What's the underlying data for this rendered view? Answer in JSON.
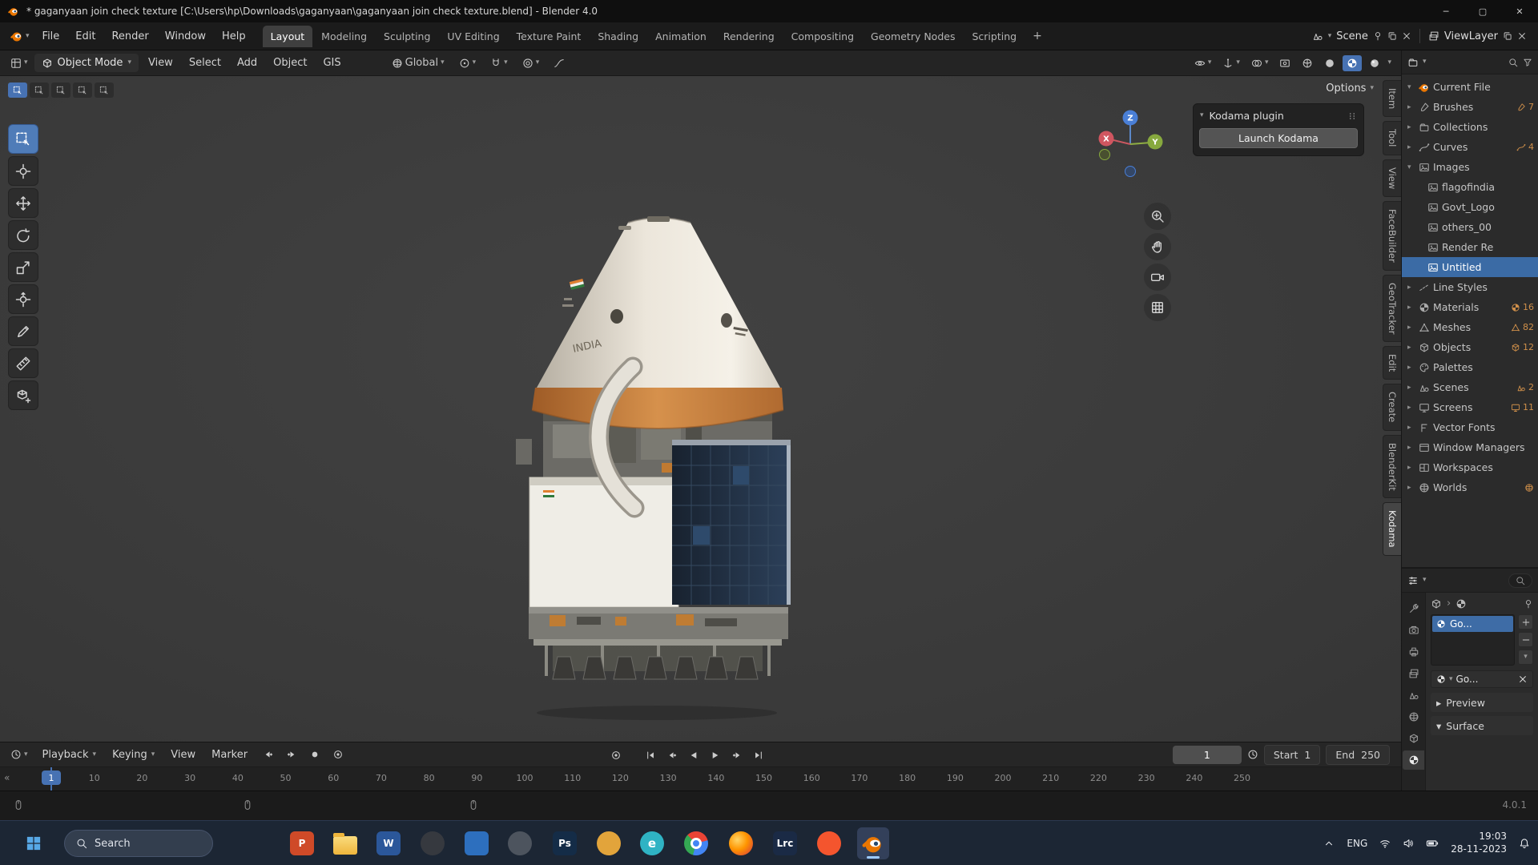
{
  "titlebar": {
    "title": "* gaganyaan join check texture [C:\\Users\\hp\\Downloads\\gaganyaan\\gaganyaan join check texture.blend] - Blender 4.0",
    "controls": {
      "minimize": "─",
      "maximize": "▢",
      "close": "✕"
    }
  },
  "topbar": {
    "menus": [
      "File",
      "Edit",
      "Render",
      "Window",
      "Help"
    ],
    "workspaces": [
      "Layout",
      "Modeling",
      "Sculpting",
      "UV Editing",
      "Texture Paint",
      "Shading",
      "Animation",
      "Rendering",
      "Compositing",
      "Geometry Nodes",
      "Scripting"
    ],
    "active_workspace": "Layout",
    "add_workspace_label": "+",
    "scene": {
      "label": "Scene"
    },
    "viewlayer": {
      "label": "ViewLayer"
    }
  },
  "viewport": {
    "header": {
      "mode_label": "Object Mode",
      "menus": [
        "View",
        "Select",
        "Add",
        "Object",
        "GIS"
      ],
      "orientation_label": "Global"
    },
    "options_label": "Options",
    "tools": [
      "select-box",
      "cursor",
      "move",
      "rotate",
      "scale",
      "transform",
      "annotate",
      "measure",
      "add-cube"
    ],
    "nav_controls": [
      "zoom",
      "pan",
      "camera",
      "grid"
    ],
    "gizmo": {
      "x": "X",
      "y": "Y",
      "z": "Z"
    },
    "side_tabs": [
      "Item",
      "Tool",
      "View",
      "FaceBuilder",
      "GeoTracker",
      "Edit",
      "Create",
      "BlenderKit",
      "Kodama"
    ],
    "active_side_tab": "Kodama",
    "kodama_panel": {
      "title": "Kodama plugin",
      "button_label": "Launch Kodama"
    },
    "model_label": "INDIA"
  },
  "outliner": {
    "root_label": "Current File",
    "items": [
      {
        "label": "Brushes",
        "icon": "brush",
        "count": "7"
      },
      {
        "label": "Collections",
        "icon": "collection",
        "count": ""
      },
      {
        "label": "Curves",
        "icon": "curve",
        "count": "4"
      },
      {
        "label": "Images",
        "icon": "image",
        "count": "",
        "expanded": true,
        "children": [
          {
            "label": "flagofindia",
            "selected": false
          },
          {
            "label": "Govt_Logo",
            "selected": false
          },
          {
            "label": "others_00",
            "selected": false
          },
          {
            "label": "Render Re",
            "selected": false
          },
          {
            "label": "Untitled",
            "selected": true
          }
        ]
      },
      {
        "label": "Line Styles",
        "icon": "linestyle",
        "count": ""
      },
      {
        "label": "Materials",
        "icon": "material",
        "count": "16"
      },
      {
        "label": "Meshes",
        "icon": "mesh",
        "count": "82"
      },
      {
        "label": "Objects",
        "icon": "object",
        "count": "12"
      },
      {
        "label": "Palettes",
        "icon": "palette",
        "count": ""
      },
      {
        "label": "Scenes",
        "icon": "scene",
        "count": "2"
      },
      {
        "label": "Screens",
        "icon": "screen",
        "count": "11"
      },
      {
        "label": "Vector Fonts",
        "icon": "font",
        "count": ""
      },
      {
        "label": "Window Managers",
        "icon": "window",
        "count": ""
      },
      {
        "label": "Workspaces",
        "icon": "workspace",
        "count": ""
      },
      {
        "label": "Worlds",
        "icon": "world",
        "count": "",
        "badge": true
      }
    ]
  },
  "properties": {
    "tabs": [
      "tool",
      "render",
      "output",
      "viewlayer",
      "scene",
      "world",
      "object",
      "material"
    ],
    "active_tab": "material",
    "material_slot_label": "Go...",
    "material_name": "Go...",
    "sections": [
      {
        "label": "Preview",
        "expanded": false
      },
      {
        "label": "Surface",
        "expanded": true
      }
    ]
  },
  "timeline": {
    "menus": [
      "Playback",
      "Keying",
      "View",
      "Marker"
    ],
    "current_frame": "1",
    "frame_field_value": "1",
    "start_label": "Start",
    "start_value": "1",
    "end_label": "End",
    "end_value": "250",
    "ticks": [
      10,
      20,
      30,
      40,
      50,
      60,
      70,
      80,
      90,
      100,
      110,
      120,
      130,
      140,
      150,
      160,
      170,
      180,
      190,
      200,
      210,
      220,
      230,
      240,
      250
    ]
  },
  "statusbar": {
    "version": "4.0.1"
  },
  "taskbar": {
    "search_label": "Search",
    "apps": [
      {
        "name": "powerpoint",
        "shape": "tile",
        "color": "#cf4a28",
        "glyph": "P"
      },
      {
        "name": "file-explorer",
        "shape": "folder",
        "color": "#f3c14b",
        "glyph": ""
      },
      {
        "name": "word",
        "shape": "tile",
        "color": "#2b579a",
        "glyph": "W"
      },
      {
        "name": "dark-utility",
        "shape": "circle",
        "color": "#36393f",
        "glyph": ""
      },
      {
        "name": "blue-app",
        "shape": "tile",
        "color": "#2d6fbe",
        "glyph": ""
      },
      {
        "name": "gray-app",
        "shape": "circle",
        "color": "#4d545e",
        "glyph": ""
      },
      {
        "name": "photoshop",
        "shape": "tile",
        "color": "#142c47",
        "glyph": "Ps"
      },
      {
        "name": "amber-app",
        "shape": "circle",
        "color": "#e2a43b",
        "glyph": ""
      },
      {
        "name": "edge",
        "shape": "circle",
        "color": "#2fb3c4",
        "glyph": "e"
      },
      {
        "name": "chrome",
        "shape": "chrome",
        "color": "",
        "glyph": ""
      },
      {
        "name": "firefox",
        "shape": "firefox",
        "color": "#ff8426",
        "glyph": ""
      },
      {
        "name": "lightroom",
        "shape": "tile",
        "color": "#1a2a45",
        "glyph": "Lrc"
      },
      {
        "name": "brave",
        "shape": "circle",
        "color": "#f4552e",
        "glyph": ""
      },
      {
        "name": "blender",
        "shape": "blender",
        "color": "#ea7600",
        "glyph": "",
        "active": true
      }
    ],
    "tray": {
      "language": "ENG",
      "time": "19:03",
      "date": "28-11-2023"
    }
  }
}
